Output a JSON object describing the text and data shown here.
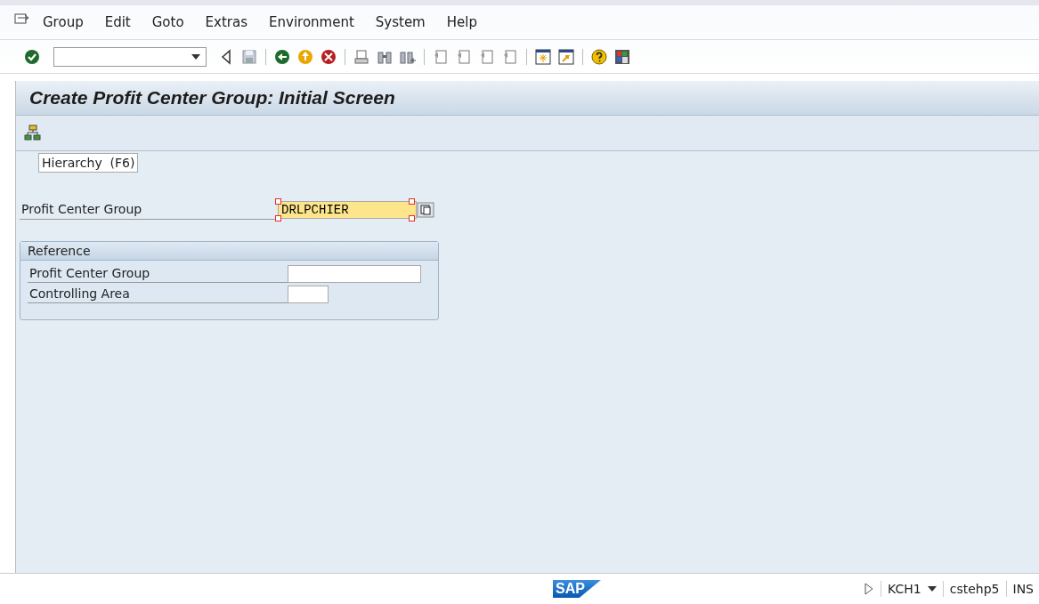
{
  "menu": [
    "Group",
    "Edit",
    "Goto",
    "Extras",
    "Environment",
    "System",
    "Help"
  ],
  "title": "Create Profit Center Group: Initial Screen",
  "tooltip": "Hierarchy  (F6)",
  "main_field": {
    "label": "Profit Center Group",
    "value": "DRLPCHIER",
    "focused": true
  },
  "reference": {
    "title": "Reference",
    "fields": [
      {
        "label": "Profit Center Group"
      },
      {
        "label": "Controlling Area"
      }
    ]
  },
  "status_bar": {
    "logo": "SAP",
    "system": "KCH1",
    "server": "cstehp5",
    "mode": "INS"
  }
}
